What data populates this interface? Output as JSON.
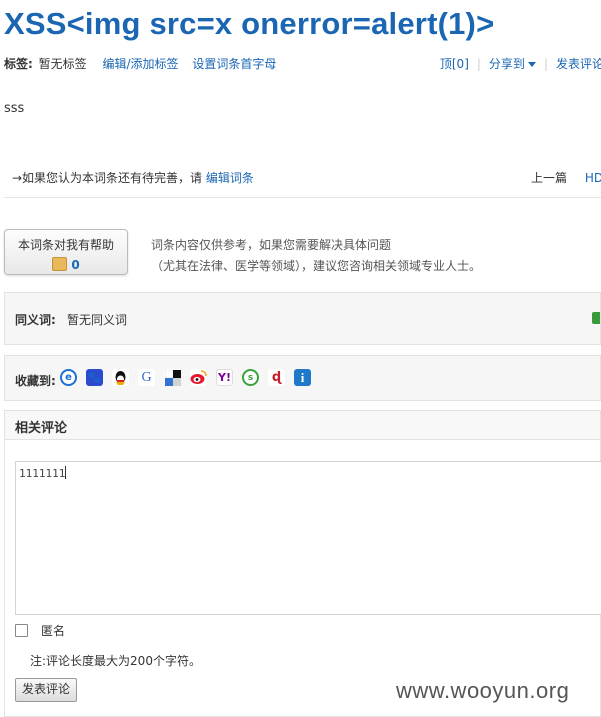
{
  "page_title": "XSS<img src=x onerror=alert(1)>",
  "tags": {
    "label": "标签:",
    "none_text": "暂无标签",
    "edit_link": "编辑/添加标签",
    "initial_link": "设置词条首字母"
  },
  "actions": {
    "top": "顶[0]",
    "share": "分享到",
    "comment": "发表评论"
  },
  "content_text": "sss",
  "edit_prompt": {
    "text": "→如果您认为本词条还有待完善，请",
    "link": "编辑词条"
  },
  "nav": {
    "prev": "上一篇",
    "next": "HDW"
  },
  "helpful": {
    "label": "本词条对我有帮助",
    "count": "0"
  },
  "disclaimer": {
    "line1": "词条内容仅供参考，如果您需要解决具体问题",
    "line2": "（尤其在法律、医学等领域），建议您咨询相关领域专业人士。"
  },
  "synonyms": {
    "label": "同义词:",
    "value": "暂无同义词"
  },
  "favorites": {
    "label": "收藏到:",
    "icons": [
      "ie-favorite-icon",
      "baidu-icon",
      "qq-icon",
      "google-icon",
      "delicious-icon",
      "sina-weibo-icon",
      "yahoo-icon",
      "sohu-icon",
      "qq-bookmark-icon",
      "info-icon"
    ]
  },
  "comments": {
    "heading": "相关评论",
    "textarea_value": "1111111",
    "anonymous_label": "匿名",
    "note": "注:评论长度最大为200个字符。",
    "submit_label": "发表评论"
  },
  "watermark": "www.wooyun.org",
  "colors": {
    "link": "#1a66b3",
    "title": "#1a66b3"
  }
}
